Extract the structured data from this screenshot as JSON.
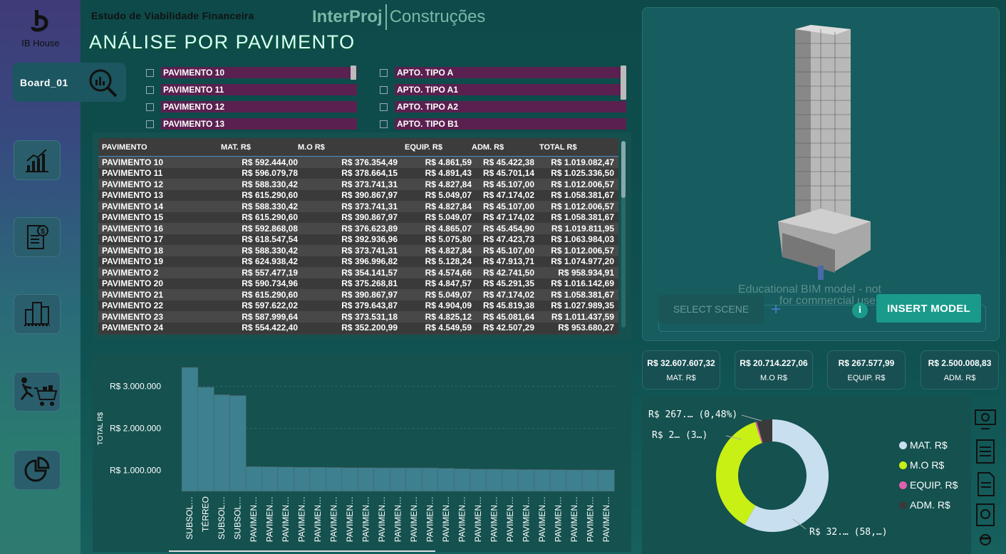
{
  "sidebar": {
    "logo_label": "IB House",
    "board_label": "Board_01",
    "nav_icons": [
      "bar-chart-icon",
      "invoice-dollar-icon",
      "buildings-icon",
      "shopping-cart-icon",
      "pie-chart-icon"
    ]
  },
  "header": {
    "subtitle": "Estudo de Viabilidade Financeira",
    "brand_bold": "InterProj",
    "brand_light": "Construções",
    "title": "ANÁLISE  POR PAVIMENTO"
  },
  "filters": {
    "pavimento": [
      "PAVIMENTO 10",
      "PAVIMENTO 11",
      "PAVIMENTO 12",
      "PAVIMENTO 13"
    ],
    "apto": [
      "APTO. TIPO A",
      "APTO. TIPO A1",
      "APTO. TIPO A2",
      "APTO. TIPO B1"
    ]
  },
  "table": {
    "headers": [
      "PAVIMENTO",
      "MAT. R$",
      "M.O R$",
      "EQUIP. R$",
      "ADM. R$",
      "TOTAL R$"
    ],
    "rows": [
      [
        "PAVIMENTO 10",
        "R$ 592.444,00",
        "R$ 376.354,49",
        "R$ 4.861,59",
        "R$ 45.422,38",
        "R$ 1.019.082,47"
      ],
      [
        "PAVIMENTO 11",
        "R$ 596.079,78",
        "R$ 378.664,15",
        "R$ 4.891,43",
        "R$ 45.701,14",
        "R$ 1.025.336,50"
      ],
      [
        "PAVIMENTO 12",
        "R$ 588.330,42",
        "R$ 373.741,31",
        "R$ 4.827,84",
        "R$ 45.107,00",
        "R$ 1.012.006,57"
      ],
      [
        "PAVIMENTO 13",
        "R$ 615.290,60",
        "R$ 390.867,97",
        "R$ 5.049,07",
        "R$ 47.174,02",
        "R$ 1.058.381,67"
      ],
      [
        "PAVIMENTO 14",
        "R$ 588.330,42",
        "R$ 373.741,31",
        "R$ 4.827,84",
        "R$ 45.107,00",
        "R$ 1.012.006,57"
      ],
      [
        "PAVIMENTO 15",
        "R$ 615.290,60",
        "R$ 390.867,97",
        "R$ 5.049,07",
        "R$ 47.174,02",
        "R$ 1.058.381,67"
      ],
      [
        "PAVIMENTO 16",
        "R$ 592.868,08",
        "R$ 376.623,89",
        "R$ 4.865,07",
        "R$ 45.454,90",
        "R$ 1.019.811,95"
      ],
      [
        "PAVIMENTO 17",
        "R$ 618.547,54",
        "R$ 392.936,96",
        "R$ 5.075,80",
        "R$ 47.423,73",
        "R$ 1.063.984,03"
      ],
      [
        "PAVIMENTO 18",
        "R$ 588.330,42",
        "R$ 373.741,31",
        "R$ 4.827,84",
        "R$ 45.107,00",
        "R$ 1.012.006,57"
      ],
      [
        "PAVIMENTO 19",
        "R$ 624.938,42",
        "R$ 396.996,82",
        "R$ 5.128,24",
        "R$ 47.913,71",
        "R$ 1.074.977,20"
      ],
      [
        "PAVIMENTO 2",
        "R$ 557.477,19",
        "R$ 354.141,57",
        "R$ 4.574,66",
        "R$ 42.741,50",
        "R$ 958.934,91"
      ],
      [
        "PAVIMENTO 20",
        "R$ 590.734,96",
        "R$ 375.268,81",
        "R$ 4.847,57",
        "R$ 45.291,35",
        "R$ 1.016.142,69"
      ],
      [
        "PAVIMENTO 21",
        "R$ 615.290,60",
        "R$ 390.867,97",
        "R$ 5.049,07",
        "R$ 47.174,02",
        "R$ 1.058.381,67"
      ],
      [
        "PAVIMENTO 22",
        "R$ 597.622,02",
        "R$ 379.643,87",
        "R$ 4.904,09",
        "R$ 45.819,38",
        "R$ 1.027.989,35"
      ],
      [
        "PAVIMENTO 23",
        "R$ 587.999,64",
        "R$ 373.531,18",
        "R$ 4.825,12",
        "R$ 45.081,64",
        "R$ 1.011.437,59"
      ],
      [
        "PAVIMENTO 24",
        "R$ 554.422,40",
        "R$ 352.200,99",
        "R$ 4.549,59",
        "R$ 42.507,29",
        "R$ 953.680,27"
      ]
    ]
  },
  "viewer": {
    "scene_placeholder": "SELECT SCENE",
    "insert_label": "INSERT MODEL",
    "watermark_line1": "Educational BIM model - not",
    "watermark_line2": "for commercial use"
  },
  "kpis": [
    {
      "value": "R$ 32.607.607,32",
      "label": "MAT. R$"
    },
    {
      "value": "R$ 20.714.227,06",
      "label": "M.O R$"
    },
    {
      "value": "R$ 267.577,99",
      "label": "EQUIP. R$"
    },
    {
      "value": "R$ 2.500.008,83",
      "label": "ADM. R$"
    }
  ],
  "donut": {
    "legend": [
      {
        "name": "MAT. R$",
        "color": "#c8dff0"
      },
      {
        "name": "M.O R$",
        "color": "#c8f014"
      },
      {
        "name": "EQUIP. R$",
        "color": "#e060b0"
      },
      {
        "name": "ADM. R$",
        "color": "#3a3a3a"
      }
    ],
    "labels": [
      "R$ 267.… (0,48%)",
      "R$ 2… (3…)",
      "R$ 32.… (58,…)"
    ]
  },
  "chart_data": {
    "type": "bar",
    "ylabel": "TOTAL R$",
    "ylim": [
      500000,
      3500000
    ],
    "yticks": [
      "R$ 1.000.000",
      "R$ 2.000.000",
      "R$ 3.000.000"
    ],
    "ytick_values": [
      1000000,
      2000000,
      3000000
    ],
    "categories": [
      "SUBSOL…",
      "TÉRREO",
      "SUBSOL…",
      "SUBSOL…",
      "PAVIMEN…",
      "PAVIMEN…",
      "PAVIMEN…",
      "PAVIMEN…",
      "PAVIMEN…",
      "PAVIMEN…",
      "PAVIMEN…",
      "PAVIMEN…",
      "PAVIMEN…",
      "PAVIMEN…",
      "PAVIMEN…",
      "PAVIMEN…",
      "PAVIMEN…",
      "PAVIMEN…",
      "PAVIMEN…",
      "PAVIMEN…",
      "PAVIMEN…",
      "PAVIMEN…",
      "PAVIMEN…",
      "PAVIMEN…",
      "PAVIMEN…",
      "PAVIMEN…",
      "PAVIMEN…"
    ],
    "values": [
      3450000,
      2980000,
      2800000,
      2780000,
      1090000,
      1085000,
      1080000,
      1075000,
      1074977,
      1070000,
      1065000,
      1063984,
      1060000,
      1058381,
      1058381,
      1058381,
      1050000,
      1040000,
      1030000,
      1027989,
      1025336,
      1019811,
      1019082,
      1016142,
      1012006,
      1012006,
      1011437
    ]
  },
  "donut_data": {
    "type": "pie",
    "values": [
      58.5,
      37.1,
      0.48,
      4.5
    ]
  }
}
